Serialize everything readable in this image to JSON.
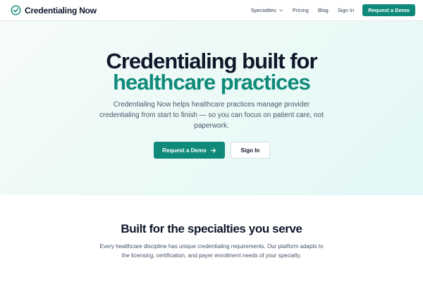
{
  "nav": {
    "brand_name": "Credentialing Now",
    "links": [
      "Specialties",
      "Pricing",
      "Blog",
      "Sign In"
    ],
    "cta_label": "Request a Demo"
  },
  "hero": {
    "title_line1": "Credentialing built for",
    "title_line2": "healthcare practices",
    "subtitle": "Credentialing Now helps healthcare practices manage provider credentialing from start to finish — so you can focus on patient care, not paperwork.",
    "primary_button": "Request a Demo",
    "secondary_button": "Sign In"
  },
  "specialties": {
    "title": "Built for the specialties you serve",
    "body": "Every healthcare discipline has unique credentialing requirements. Our platform adapts to the licensing, certification, and payer enrollment needs of your specialty."
  },
  "colors": {
    "accent": "#0f8a7a",
    "text_dark": "#0f172a",
    "text_muted": "#475569",
    "hero_bg": "#e8f8f5"
  },
  "icons": {
    "logo": "check-circle-icon",
    "dropdown": "chevron-down-icon",
    "cta_arrow": "arrow-right-icon"
  }
}
